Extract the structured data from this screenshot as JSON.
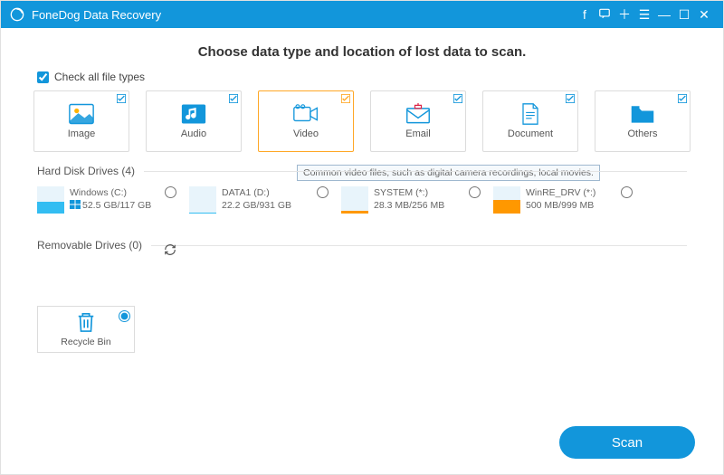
{
  "header": {
    "title": "FoneDog Data Recovery"
  },
  "heading": "Choose data type and location of lost data to scan.",
  "check_all_label": "Check all file types",
  "types": [
    {
      "id": "image",
      "label": "Image"
    },
    {
      "id": "audio",
      "label": "Audio"
    },
    {
      "id": "video",
      "label": "Video"
    },
    {
      "id": "email",
      "label": "Email"
    },
    {
      "id": "document",
      "label": "Document"
    },
    {
      "id": "others",
      "label": "Others"
    }
  ],
  "video_tooltip": "Common video files, such as digital camera recordings, local movies.",
  "sections": {
    "hdd": {
      "title": "Hard Disk Drives (4)"
    },
    "removable": {
      "title": "Removable Drives (0)"
    }
  },
  "drives": [
    {
      "name": "Windows (C:)",
      "size": "52.5 GB/117 GB",
      "fill": 0.45,
      "color": "#33bdf2",
      "winlogo": true
    },
    {
      "name": "DATA1 (D:)",
      "size": "22.2 GB/931 GB",
      "fill": 0.05,
      "color": "#33bdf2",
      "winlogo": false
    },
    {
      "name": "SYSTEM (*:)",
      "size": "28.3 MB/256 MB",
      "fill": 0.11,
      "color": "#ff9800",
      "winlogo": false
    },
    {
      "name": "WinRE_DRV (*:)",
      "size": "500 MB/999 MB",
      "fill": 0.5,
      "color": "#ff9800",
      "winlogo": false
    }
  ],
  "recycle": {
    "label": "Recycle Bin",
    "selected": true
  },
  "scan_label": "Scan",
  "colors": {
    "accent": "#1296db",
    "highlight": "#ffa726"
  }
}
